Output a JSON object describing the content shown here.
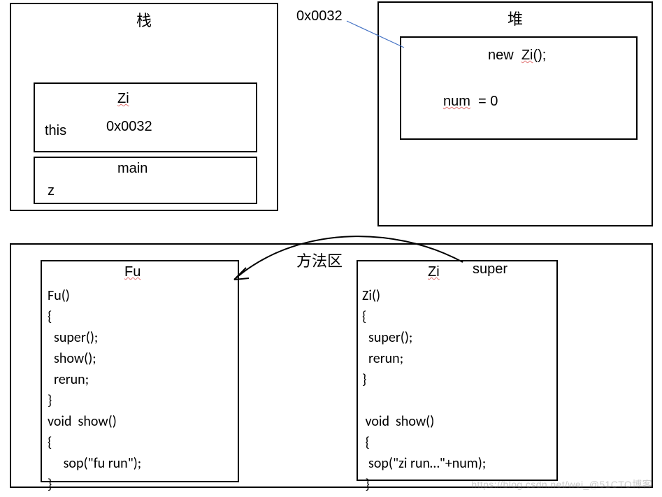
{
  "watermark": "https://blog.csdn.net/wei_@51CTO博客",
  "stack": {
    "title": "栈",
    "frame_top": {
      "class_name": "Zi",
      "this_label": "this",
      "this_value": "0x0032"
    },
    "frame_bottom": {
      "label": "main",
      "var": "z"
    }
  },
  "pointer_label": "0x0032",
  "heap": {
    "title": "堆",
    "object_heading": "new  Zi();",
    "field": "num  = 0"
  },
  "method_area": {
    "title": "方法区",
    "super_label": "super",
    "fu": {
      "name": "Fu",
      "code": "Fu()\n{\n  super();\n  show();\n  rerun;\n}\nvoid  show()\n{\n     sop(\"fu run\");\n}"
    },
    "zi": {
      "name": "Zi",
      "code": "Zi()\n{\n  super();\n  rerun;\n}\n\n void  show()\n {\n  sop(\"zi run…\"+num);\n }"
    }
  }
}
